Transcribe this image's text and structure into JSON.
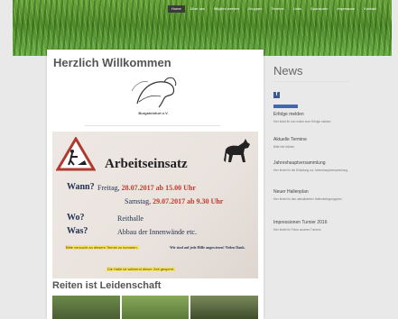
{
  "nav": {
    "items": [
      "Home",
      "Über uns",
      "Mitglied werden",
      "Gruppen",
      "Termine",
      "Links",
      "Sponsoren",
      "Impressum",
      "Kontakt"
    ]
  },
  "main": {
    "title": "Herzlich Willkommen",
    "logo_text": "Burgsteinfurt e.V.",
    "flyer": {
      "title": "Arbeitseinsatz",
      "wann_label": "Wann?",
      "wann_line1_prefix": "Freitag,",
      "wann_line1_value": "28.07.2017 ab 15.00 Uhr",
      "wann_line2_prefix": "Samstag,",
      "wann_line2_value": "29.07.2017 ab 9.30 Uhr",
      "wo_label": "Wo?",
      "wo_value": "Reithalle",
      "was_label": "Was?",
      "was_value": "Abbau der Innenwände etc.",
      "note1": "Bitte versucht an diesem Termin zu kommen.",
      "note2": "Wir sind auf jede Hilfe angewiesen! Vielen Dank.",
      "note3": "Die Halle ist während dieser Zeit gesperrt."
    },
    "section2_title": "Reiten ist Leidenschaft"
  },
  "sidebar": {
    "title": "News",
    "fb_icon": "facebook-icon",
    "items": [
      {
        "heading": "Erfolge melden",
        "text": "Hier klickt ihr nun online eure Erfolge melden"
      },
      {
        "heading": "Aktuelle Termine",
        "text": "Bitte hier klicken"
      },
      {
        "heading": "Jahreshauptversammlung",
        "text": "Hier findet ihr die Einladung zur Jahreshauptversammlung"
      },
      {
        "heading": "Neuer Hallenplan",
        "text": "Hier findet ihr den aktualisierten Hallenbelegungsplan"
      },
      {
        "heading": "Impressionen Turnier 2016",
        "text": "Hier findet ihr Fotos unseres Turniers"
      }
    ]
  },
  "colors": {
    "accent_red": "#c0392b",
    "fb_blue": "#3b5998",
    "grass": "#4f8a2a"
  }
}
